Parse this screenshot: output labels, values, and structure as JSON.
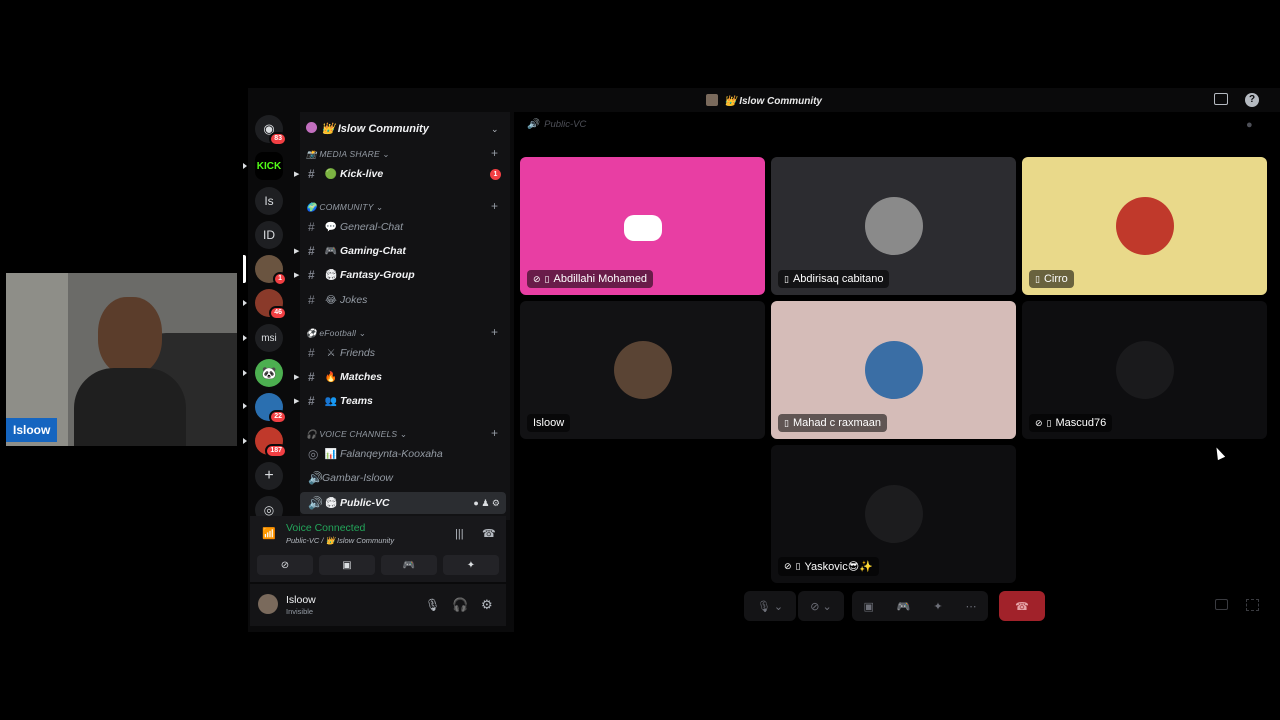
{
  "window": {
    "title": "👑 Islow Community"
  },
  "servers": [
    {
      "label": "",
      "badge": "83",
      "color": "#1e1f22",
      "icon": "discord-icon"
    },
    {
      "label": "KICK",
      "badge": "",
      "color": "#000000"
    },
    {
      "label": "Is",
      "badge": "",
      "color": "#1e1f22"
    },
    {
      "label": "ID",
      "badge": "",
      "color": "#1e1f22"
    },
    {
      "label": "",
      "badge": "1",
      "color": "#6a5440"
    },
    {
      "label": "",
      "badge": "46",
      "color": "#8a3a2a"
    },
    {
      "label": "msi",
      "badge": "",
      "color": "#1e1f22"
    },
    {
      "label": "",
      "badge": "",
      "color": "#4caf50"
    },
    {
      "label": "",
      "badge": "22",
      "color": "#2a6fb0"
    },
    {
      "label": "",
      "badge": "187",
      "color": "#c0392b"
    }
  ],
  "sidebar": {
    "server_name": "👑 Islow Community",
    "categories": {
      "media": "MEDIA SHARE",
      "community": "COMMUNITY",
      "efootball": "eFootball",
      "voice": "VOICE CHANNELS"
    },
    "channels": {
      "kick": {
        "label": "Kick-live",
        "badge": "1"
      },
      "general": {
        "label": "General-Chat"
      },
      "gaming": {
        "label": "Gaming-Chat"
      },
      "fantasy": {
        "label": "Fantasy-Group"
      },
      "jokes": {
        "label": "Jokes"
      },
      "friends": {
        "label": "Friends"
      },
      "matches": {
        "label": "Matches"
      },
      "teams": {
        "label": "Teams"
      },
      "falanqeynta": {
        "label": "Falanqeynta-Kooxaha"
      },
      "gambar": {
        "label": "Gambar-Isloow"
      },
      "public": {
        "label": "Public-VC"
      }
    }
  },
  "voice": {
    "status": "Voice Connected",
    "location": "Public-VC / 👑 Islow Community"
  },
  "user": {
    "name": "Isloow",
    "status": "Invisible"
  },
  "main": {
    "channel": "Public-VC",
    "participants": [
      {
        "name": "Abdillahi Mohamed",
        "bg": "#e83ea3"
      },
      {
        "name": "Abdirisaq cabitano",
        "bg": "#2c2c30"
      },
      {
        "name": "Cirro",
        "bg": "#e9d98a"
      },
      {
        "name": "Isloow",
        "bg": "#121214"
      },
      {
        "name": "Mahad c raxmaan",
        "bg": "#d5bcb8"
      },
      {
        "name": "Mascud76",
        "bg": "#0e0e10"
      },
      {
        "name": "Yaskovic😎✨",
        "bg": "#0e0e10"
      }
    ]
  },
  "webcam": {
    "label": "Isloow"
  }
}
